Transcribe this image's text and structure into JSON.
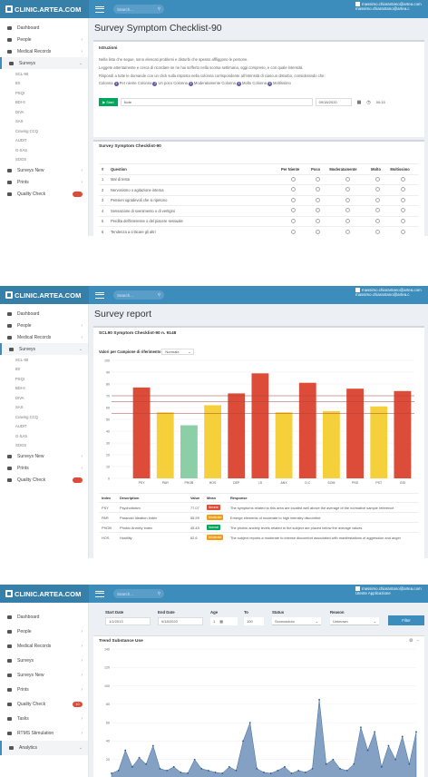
{
  "topbar": {
    "brand": "CLINIC.ARTEA.COM",
    "search_placeholder": "Search...",
    "user_line1": "massimo.chiarantano@artea.com",
    "user_line2": "massimo.chiarantano@artea.c",
    "user_caption": "Utente Applicazione"
  },
  "sidebar_a": {
    "items": [
      {
        "label": "Dashboard",
        "icon": "dashboard-icon"
      },
      {
        "label": "People",
        "icon": "people-icon"
      },
      {
        "label": "Medical Records",
        "icon": "medical-records-icon"
      },
      {
        "label": "Surveys",
        "icon": "surveys-icon"
      }
    ],
    "subs": [
      "SCL-90",
      "IDI",
      "PSQI",
      "BDI-II",
      "DIVA",
      "SAS",
      "Craving CCQ",
      "AUDIT",
      "G-SAS",
      "SOGS"
    ],
    "after": [
      {
        "label": "Surveys New",
        "icon": "surveys-new-icon"
      },
      {
        "label": "Prints",
        "icon": "prints-icon"
      },
      {
        "label": "Quality Check",
        "icon": "quality-check-icon"
      }
    ]
  },
  "sidebar_c": {
    "items": [
      {
        "label": "Dashboard",
        "icon": "dashboard-icon"
      },
      {
        "label": "People",
        "icon": "people-icon"
      },
      {
        "label": "Medical Records",
        "icon": "medical-records-icon"
      },
      {
        "label": "Surveys",
        "icon": "surveys-icon"
      },
      {
        "label": "Surveys New",
        "icon": "surveys-new-icon"
      },
      {
        "label": "Prints",
        "icon": "prints-icon"
      },
      {
        "label": "Quality Check",
        "icon": "quality-check-icon",
        "badge": "10"
      },
      {
        "label": "Tasks",
        "icon": "tasks-icon"
      },
      {
        "label": "RTMS Stimulation",
        "icon": "rtms-icon"
      },
      {
        "label": "Analytics",
        "icon": "analytics-icon"
      }
    ]
  },
  "checklist": {
    "page_title": "Survey Symptom Checklist-90",
    "instructions_title": "Istruzioni",
    "instr1": "Nella lista che segue, sono elencati problemi e disturbi che spesso affliggono le persone.",
    "instr2": "Leggete attentamente e cerca di ricordare se ne hai sofferto nella scorsa settimana, oggi compreso, e con quale intensità.",
    "instr3": "Rispondi a tutte le domande con un click sulla risposta nella colonna corrispondente all'intensità di ciascun disturbo, considerando che:",
    "legend_prefix": "Colonna",
    "legend": [
      {
        "n": "1",
        "label": "Per niente"
      },
      {
        "n": "2",
        "label": "Un poco"
      },
      {
        "n": "3",
        "label": "Moderatamente"
      },
      {
        "n": "4",
        "label": "Molto"
      },
      {
        "n": "5",
        "label": "Moltissimo"
      }
    ],
    "start_label": "▶ Start",
    "note_placeholder": "Note",
    "date": "09/18/2020",
    "time": "00:15",
    "table_title": "Survey Symptom Checklist-90",
    "columns": [
      "#",
      "Question",
      "Per Niente",
      "Poco",
      "Moderatamente",
      "Molto",
      "Moltissimo"
    ],
    "rows": [
      {
        "n": "1",
        "q": "Mal di testa"
      },
      {
        "n": "2",
        "q": "Nervosismo o agitazione interna"
      },
      {
        "n": "3",
        "q": "Pensieri sgradevoli che si ripetono"
      },
      {
        "n": "4",
        "q": "Sensazione di svenimento o di vertigini"
      },
      {
        "n": "5",
        "q": "Perdita dell'interesse o del piacere sessuale"
      },
      {
        "n": "6",
        "q": "Tendenza a criticare gli altri"
      }
    ]
  },
  "report": {
    "page_title": "Survey report",
    "subtitle": "SCL90 Symptom Checklist-90 n. 9148",
    "chart_caption": "Valori per Campione di riferimento",
    "select_value": "Normale",
    "columns": [
      "Index",
      "Description",
      "Value",
      "Mean",
      "Response"
    ],
    "rows": [
      {
        "index": "PSY",
        "desc": "Psychoticism",
        "value": "77.07",
        "mean": "Severe",
        "color": "#dd4b39",
        "resp": "The symptoms related to this area are located well above the average of the normative sample reference"
      },
      {
        "index": "PAR",
        "desc": "Paranoid Ideation Index",
        "value": "55.99",
        "mean": "Moderate",
        "color": "#f39c12",
        "resp": "Emerge elements of moderate to high intensity discomfort"
      },
      {
        "index": "PHOB",
        "desc": "Phobic Anxiety Index",
        "value": "45.45",
        "mean": "Normal",
        "color": "#00a65a",
        "resp": "The phobic anxiety levels related to the subject are placed below the average values"
      },
      {
        "index": "HOS",
        "desc": "Hostility",
        "value": "62.6",
        "mean": "Moderate",
        "color": "#f39c12",
        "resp": "The subject reports a moderate to intense discomfort associated with manifestations of aggression and anger"
      }
    ]
  },
  "analytics": {
    "filters": {
      "start_label": "Start Date",
      "start_value": "1/1/2013",
      "end_label": "End Date",
      "end_value": "9/18/2020",
      "age_label": "Age",
      "age_value": "1",
      "to_label": "To",
      "to_value": "100",
      "status_label": "Status",
      "status_value": "Sconosciuto",
      "reason_label": "Reason",
      "reason_value": "Unknown",
      "filter_button": "Filter"
    },
    "chart_title": "Trend Substance Use"
  },
  "chart_data": [
    {
      "type": "bar",
      "title": "",
      "categories": [
        "PSY",
        "PAR",
        "PHOB",
        "HOS",
        "DEP",
        "I-S",
        "ANX",
        "O-C",
        "SOM",
        "PSD",
        "PST",
        "GSI"
      ],
      "values": [
        77,
        56,
        45,
        62,
        72,
        89,
        56,
        81,
        57,
        76,
        61,
        74
      ],
      "colors": [
        "#dd4b39",
        "#f5d03b",
        "#8ccfa7",
        "#f5d03b",
        "#dd4b39",
        "#dd4b39",
        "#f5d03b",
        "#dd4b39",
        "#f5d03b",
        "#dd4b39",
        "#f5d03b",
        "#dd4b39"
      ],
      "reference_lines": [
        55,
        65,
        70
      ],
      "ylim": [
        0,
        100
      ],
      "yticks": [
        0,
        10,
        20,
        30,
        40,
        50,
        60,
        70,
        80,
        90,
        100
      ]
    },
    {
      "type": "area",
      "title": "Trend Substance Use",
      "ylim": [
        0,
        140
      ],
      "yticks": [
        0,
        20,
        40,
        60,
        80,
        100,
        120,
        140
      ],
      "x": [
        0,
        1,
        2,
        3,
        4,
        5,
        6,
        7,
        8,
        9,
        10,
        11,
        12,
        13,
        14,
        15,
        16,
        17,
        18,
        19,
        20,
        21,
        22,
        23,
        24,
        25,
        26,
        27,
        28,
        29,
        30,
        31,
        32,
        33,
        34,
        35,
        36,
        37,
        38,
        39,
        40,
        41,
        42,
        43,
        44
      ],
      "values": [
        5,
        8,
        30,
        12,
        22,
        15,
        35,
        10,
        8,
        12,
        6,
        5,
        20,
        10,
        8,
        6,
        5,
        12,
        8,
        40,
        60,
        10,
        6,
        5,
        8,
        12,
        5,
        8,
        6,
        10,
        85,
        15,
        20,
        10,
        8,
        15,
        55,
        30,
        50,
        12,
        35,
        20,
        45,
        15,
        50
      ]
    }
  ]
}
